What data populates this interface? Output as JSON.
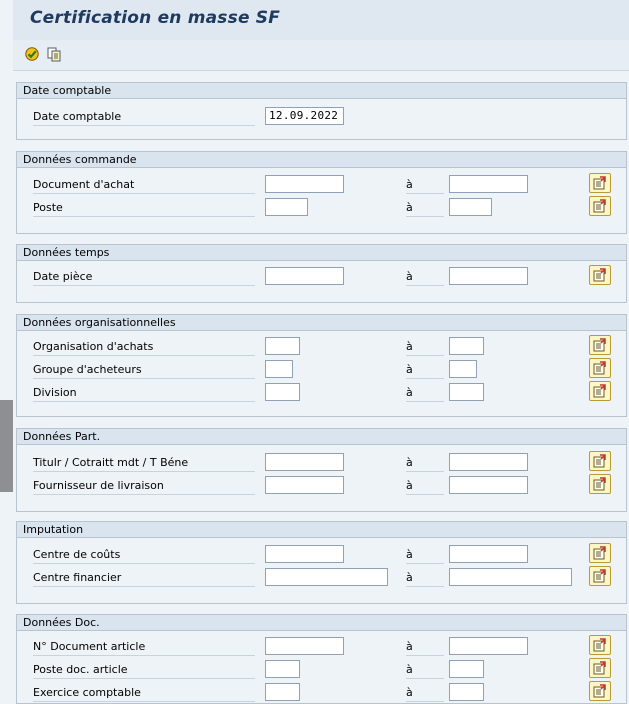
{
  "title": "Certification en masse SF",
  "toolbar": {
    "icons": [
      "execute-icon",
      "copy-variant-icon"
    ]
  },
  "range_label": "à",
  "sections": {
    "date_comptable": {
      "header": "Date comptable",
      "rows": [
        {
          "label": "Date comptable",
          "value": "12.09.2022"
        }
      ]
    },
    "commande": {
      "header": "Données commande",
      "rows": [
        {
          "label": "Document d'achat",
          "from": "",
          "to": ""
        },
        {
          "label": "Poste",
          "from": "",
          "to": ""
        }
      ]
    },
    "temps": {
      "header": "Données temps",
      "rows": [
        {
          "label": "Date pièce",
          "from": "",
          "to": ""
        }
      ]
    },
    "organisationnelles": {
      "header": "Données organisationnelles",
      "rows": [
        {
          "label": "Organisation d'achats",
          "from": "",
          "to": ""
        },
        {
          "label": "Groupe d'acheteurs",
          "from": "",
          "to": ""
        },
        {
          "label": "Division",
          "from": "",
          "to": ""
        }
      ]
    },
    "part": {
      "header": "Données Part.",
      "rows": [
        {
          "label": "Titulr / Cotraitt mdt / T Béne",
          "from": "",
          "to": ""
        },
        {
          "label": "Fournisseur de livraison",
          "from": "",
          "to": ""
        }
      ]
    },
    "imputation": {
      "header": "Imputation",
      "rows": [
        {
          "label": "Centre de coûts",
          "from": "",
          "to": ""
        },
        {
          "label": "Centre financier",
          "from": "",
          "to": ""
        }
      ]
    },
    "doc": {
      "header": "Données Doc.",
      "rows": [
        {
          "label": "N° Document article",
          "from": "",
          "to": ""
        },
        {
          "label": "Poste doc. article",
          "from": "",
          "to": ""
        },
        {
          "label": "Exercice comptable",
          "from": "",
          "to": ""
        }
      ]
    }
  }
}
